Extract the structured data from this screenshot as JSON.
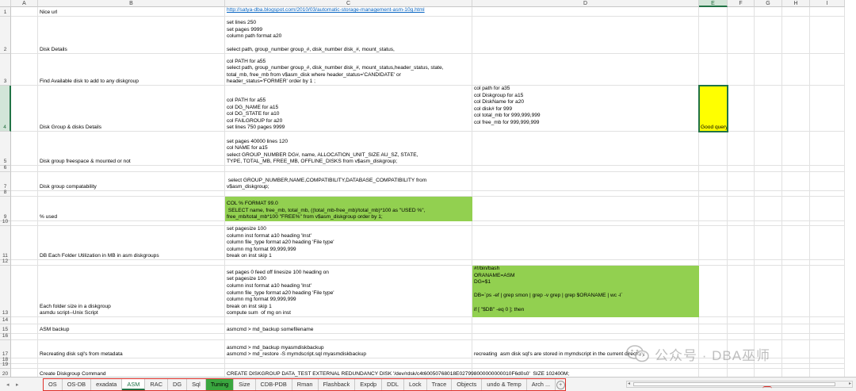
{
  "sheet": {
    "columns": [
      "A",
      "B",
      "C",
      "D",
      "E",
      "F",
      "G",
      "H",
      "I"
    ],
    "selected_column": "E",
    "selected_row": "4",
    "rows": [
      {
        "num": "1",
        "b": "Nice url",
        "c": "http://satya-dba.blogspot.com/2010/03/automatic-storage-management-asm-10g.html",
        "d": "",
        "e": ""
      },
      {
        "num": "2",
        "b": "Disk Details",
        "c": "set lines 250\nset pages 9999\ncolumn path format a20\n\nselect path, group_number group_#, disk_number disk_#, mount_status,",
        "d": "",
        "e": ""
      },
      {
        "num": "3",
        "b": "Find Available disk to add to any diskgroup",
        "c": "col PATH for a55\nselect path, group_number group_#, disk_number disk_#, mount_status,header_status, state,\ntotal_mb, free_mb from v$asm_disk where header_status='CANDIDATE' or\nheader_status='FORMER' order by 1 ;",
        "d": "",
        "e": ""
      },
      {
        "num": "4",
        "b": "Disk Group & disks Details",
        "c": "col PATH for a55\ncol DG_NAME for a15\ncol DG_STATE for a10\ncol FAILGROUP for a20\nset lines 750 pages 9999",
        "d": "col path for a35\ncol Diskgroup for a15\ncol DiskName for a20\ncol disk# for 999\ncol total_mb for 999,999,999\ncol free_mb for 999,999,999",
        "e": "Good query"
      },
      {
        "num": "5",
        "b": "Disk group freespace & mounted or not",
        "c": "set pages 40000 lines 120\ncol NAME for a15\nselect GROUP_NUMBER DG#, name, ALLOCATION_UNIT_SIZE AU_SZ, STATE,\nTYPE, TOTAL_MB, FREE_MB, OFFLINE_DISKS from v$asm_diskgroup;",
        "d": "",
        "e": ""
      },
      {
        "num": "6",
        "b": "",
        "c": "",
        "d": "",
        "e": ""
      },
      {
        "num": "7",
        "b": "Disk group compatability",
        "c": " select GROUP_NUMBER,NAME,COMPATIBILITY,DATABASE_COMPATIBILITY from\nv$asm_diskgroup;",
        "d": "",
        "e": ""
      },
      {
        "num": "8",
        "b": "",
        "c": "",
        "d": "",
        "e": ""
      },
      {
        "num": "9",
        "b": "% used",
        "c": "COL % FORMAT 99.0\n SELECT name, free_mb, total_mb, ((total_mb-free_mb)/total_mb)*100 as \"USED %\",\nfree_mb/total_mb*100 \"FREE%\" from v$asm_diskgroup order by 1;",
        "d": "",
        "e": ""
      },
      {
        "num": "10",
        "b": "",
        "c": "",
        "d": "",
        "e": ""
      },
      {
        "num": "11",
        "b": "DB Each Folder Utilization in MB in asm diskgroups",
        "c": "set pagesize 100\ncolumn inst format a10 heading 'Inst'\ncolumn file_type format a20 heading 'File type'\ncolumn mg format 99,999,999\nbreak on inst skip 1",
        "d": "",
        "e": ""
      },
      {
        "num": "12",
        "b": "",
        "c": "",
        "d": "",
        "e": ""
      },
      {
        "num": "13",
        "b": "Each folder size in a diskgroup\nasmdu script--Unix Script",
        "c": "set pages 0 feed off linesize 100 heading on\nset pagesize 100\ncolumn inst format a10 heading 'Inst'\ncolumn file_type format a20 heading 'File type'\ncolumn mg format 99,999,999\nbreak on inst skip 1\ncompute sum  of mg on inst",
        "d": "#!/bin/bash\nORANAME=ASM\nDG=$1\n\nDB=`ps -ef | grep smon | grep -v grep | grep $ORANAME | wc -l`\n\nif [ \"$DB\" -eq 0 ]; then",
        "e": ""
      },
      {
        "num": "14",
        "b": "",
        "c": "",
        "d": "",
        "e": ""
      },
      {
        "num": "15",
        "b": "ASM backup",
        "c": "asmcmd > md_backup somefilename",
        "d": "",
        "e": ""
      },
      {
        "num": "16",
        "b": "",
        "c": "",
        "d": "",
        "e": ""
      },
      {
        "num": "17",
        "b": "Recreating disk sql's from metadata",
        "c": "asmcmd > md_backup myasmdiskbackup\nasmcmd > md_restore -S mymdscript.sql myasmdiskbackup",
        "d": "recreating  asm disk sql's are stored in mymdscript in the current directory",
        "e": ""
      },
      {
        "num": "18",
        "b": "",
        "c": "",
        "d": "",
        "e": ""
      },
      {
        "num": "19",
        "b": "",
        "c": "",
        "d": "",
        "e": ""
      },
      {
        "num": "20",
        "b": "Create Diskgroup Command",
        "c": "CREATE DISKGROUP DATA_TEST EXTERNAL REDUNDANCY DISK '/dev/rdsk/c4t60050768018E027998000000000010F6d0s0'  SIZE 102400M;",
        "d": "",
        "e": ""
      }
    ]
  },
  "tabs": [
    "OS",
    "OS-DB",
    "exadata",
    "ASM",
    "RAC",
    "DG",
    "Sql",
    "Tuning",
    "Size",
    "CDB-PDB",
    "Rman",
    "Flashback",
    "Expdp",
    "DDL",
    "Lock",
    "Trace",
    "Objects",
    "undo & Temp",
    "Arch ..."
  ],
  "active_tab": "ASM",
  "highlight_tab": "Tuning",
  "watermark": "公众号 · DBA巫师",
  "colors": {
    "green_fill": "#92d050",
    "yellow_fill": "#ffff00",
    "excel_green": "#217346",
    "tab_highlight": "#3aa63f",
    "annotation_red": "#e0302a"
  }
}
